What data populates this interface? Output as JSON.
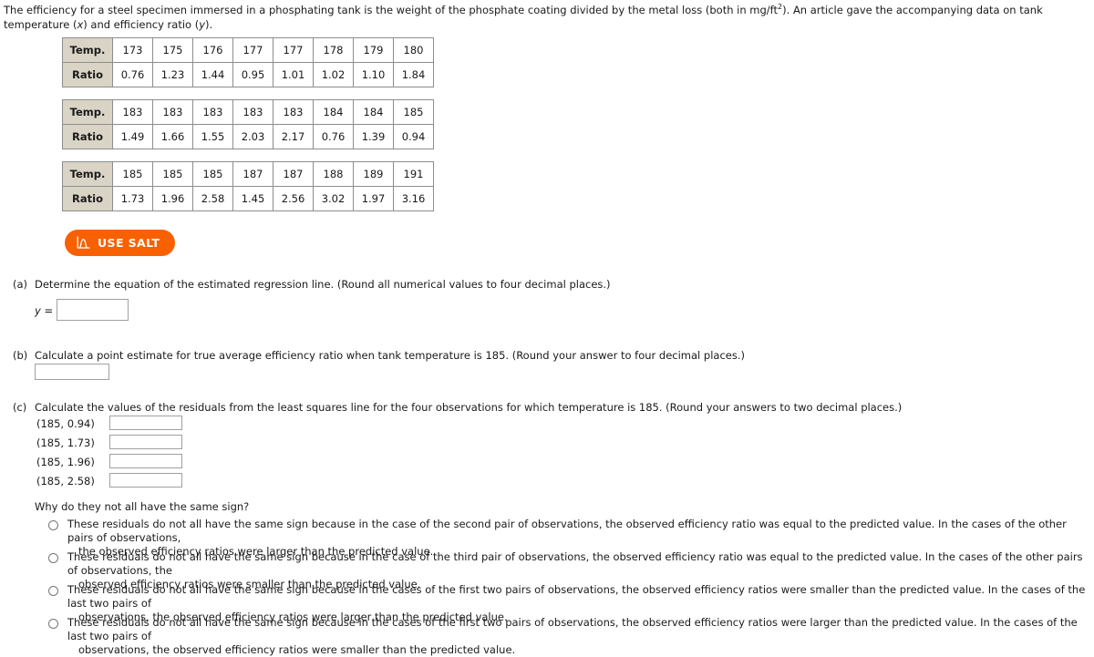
{
  "problem": {
    "intro_part1": "The efficiency for a steel specimen immersed in a phosphating tank is the weight of the phosphate coating divided by the metal loss (both in mg/ft",
    "intro_sup": "2",
    "intro_part2": "). An article gave the accompanying data on tank temperature (",
    "intro_x": "x",
    "intro_part3": ") and efficiency ratio (",
    "intro_y": "y",
    "intro_part4": ")."
  },
  "tables": [
    {
      "row_labels": [
        "Temp.",
        "Ratio"
      ],
      "temp": [
        "173",
        "175",
        "176",
        "177",
        "177",
        "178",
        "179",
        "180"
      ],
      "ratio": [
        "0.76",
        "1.23",
        "1.44",
        "0.95",
        "1.01",
        "1.02",
        "1.10",
        "1.84"
      ]
    },
    {
      "row_labels": [
        "Temp.",
        "Ratio"
      ],
      "temp": [
        "183",
        "183",
        "183",
        "183",
        "183",
        "184",
        "184",
        "185"
      ],
      "ratio": [
        "1.49",
        "1.66",
        "1.55",
        "2.03",
        "2.17",
        "0.76",
        "1.39",
        "0.94"
      ]
    },
    {
      "row_labels": [
        "Temp.",
        "Ratio"
      ],
      "temp": [
        "185",
        "185",
        "185",
        "187",
        "187",
        "188",
        "189",
        "191"
      ],
      "ratio": [
        "1.73",
        "1.96",
        "2.58",
        "1.45",
        "2.56",
        "3.02",
        "1.97",
        "3.16"
      ]
    }
  ],
  "salt_button": {
    "label": "USE SALT",
    "icon": "distribution-curve-icon",
    "color": "#f86000"
  },
  "part_a": {
    "marker": "(a)",
    "prompt": "Determine the equation of the estimated regression line. (Round all numerical values to four decimal places.)",
    "y_label": "y =",
    "input_value": "",
    "input_placeholder": ""
  },
  "part_b": {
    "marker": "(b)",
    "prompt": "Calculate a point estimate for true average efficiency ratio when tank temperature is 185. (Round your answer to four decimal places.)",
    "input_value": "",
    "input_placeholder": ""
  },
  "part_c": {
    "marker": "(c)",
    "prompt": "Calculate the values of the residuals from the least squares line for the four observations for which temperature is 185. (Round your answers to two decimal places.)",
    "rows": [
      {
        "coord": "(185, 0.94)",
        "value": ""
      },
      {
        "coord": "(185, 1.73)",
        "value": ""
      },
      {
        "coord": "(185, 1.96)",
        "value": ""
      },
      {
        "coord": "(185, 2.58)",
        "value": ""
      }
    ],
    "why_question": "Why do they not all have the same sign?",
    "options": [
      {
        "line1": "These residuals do not all have the same sign because in the case of the second pair of observations, the observed efficiency ratio was equal to the predicted value. In the cases of the other pairs of observations,",
        "line2": "the observed efficiency ratios were larger than the predicted value.",
        "selected": false
      },
      {
        "line1": "These residuals do not all have the same sign because in the case of the third pair of observations, the observed efficiency ratio was equal to the predicted value. In the cases of the other pairs of observations, the",
        "line2": "observed efficiency ratios were smaller than the predicted value.",
        "selected": false
      },
      {
        "line1": "These residuals do not all have the same sign because in the cases of the first two pairs of observations, the observed efficiency ratios were smaller than the predicted value. In the cases of the last two pairs of",
        "line2": "observations, the observed efficiency ratios were larger than the predicted value.",
        "selected": false
      },
      {
        "line1": "These residuals do not all have the same sign because in the cases of the first two pairs of observations, the observed efficiency ratios were larger than the predicted value. In the cases of the last two pairs of",
        "line2": "observations, the observed efficiency ratios were smaller than the predicted value.",
        "selected": false
      }
    ]
  }
}
